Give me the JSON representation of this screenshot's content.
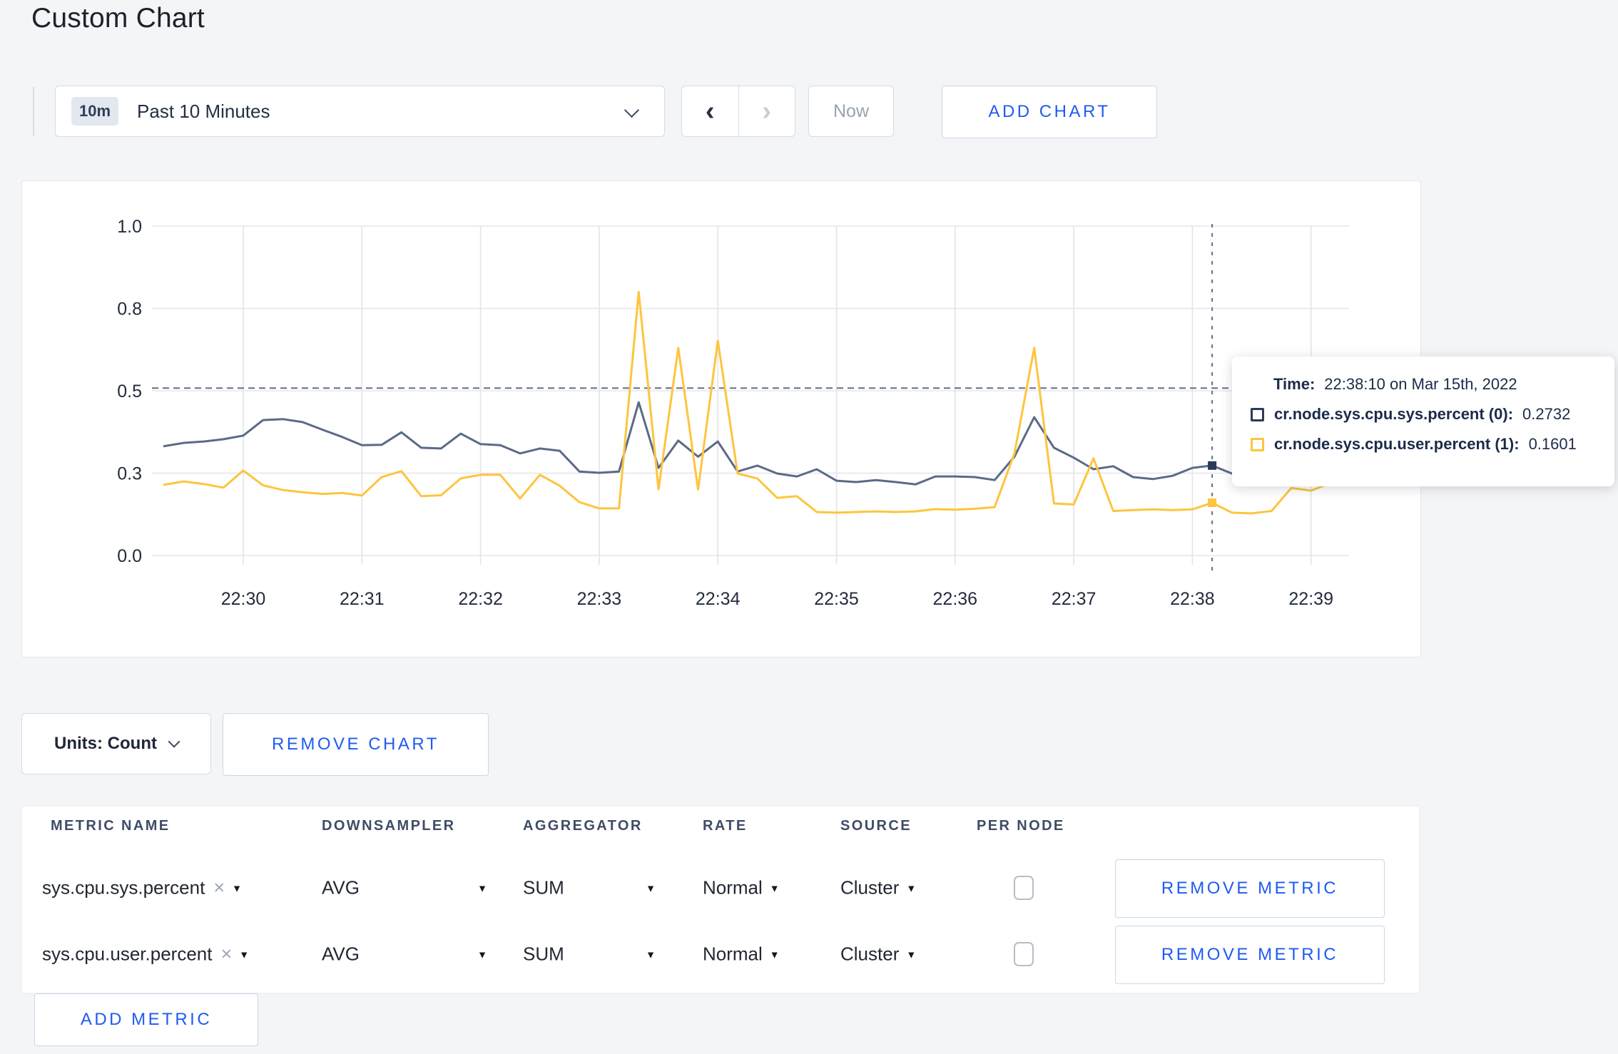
{
  "page": {
    "title": "Custom Chart"
  },
  "colors": {
    "accent_blue": "#1f5af2",
    "background": "#f4f5f7",
    "series_sys": "#5a6b87",
    "series_user": "#fdc53e",
    "crosshair": "#5e6f8a"
  },
  "icons": {
    "caret_down": "▼",
    "close": "×",
    "chevron_left": "‹",
    "chevron_right": "›"
  },
  "toolbar": {
    "time_range": {
      "badge": "10m",
      "label": "Past 10 Minutes"
    },
    "now_label": "Now",
    "add_chart_label": "ADD CHART"
  },
  "chart": {
    "tooltip": {
      "time_label": "Time:",
      "time_value": "22:38:10 on Mar 15th, 2022",
      "series": [
        {
          "label": "cr.node.sys.cpu.sys.percent (0):",
          "value": "0.2732",
          "color": "#2b3a58"
        },
        {
          "label": "cr.node.sys.cpu.user.percent (1):",
          "value": "0.1601",
          "color": "#fdc53e"
        }
      ]
    }
  },
  "chart_data": {
    "type": "line",
    "title": "",
    "xlabel": "",
    "ylabel": "",
    "ylim": [
      0,
      1
    ],
    "grid": true,
    "legend": "none",
    "xticks": [
      "22:30",
      "22:31",
      "22:32",
      "22:33",
      "22:34",
      "22:35",
      "22:36",
      "22:37",
      "22:38",
      "22:39"
    ],
    "yticks": {
      "values": [
        0,
        0.25,
        0.5,
        0.75,
        1.0
      ],
      "labels": [
        "0.0",
        "0.3",
        "0.5",
        "0.8",
        "1.0"
      ]
    },
    "crosshair": {
      "time": "22:38:10",
      "y": 0.508
    },
    "hover_points": [
      0.2732,
      0.1601
    ],
    "x": [
      "22:29:20",
      "22:29:30",
      "22:29:40",
      "22:29:50",
      "22:30:00",
      "22:30:10",
      "22:30:20",
      "22:30:30",
      "22:30:40",
      "22:30:50",
      "22:31:00",
      "22:31:10",
      "22:31:20",
      "22:31:30",
      "22:31:40",
      "22:31:50",
      "22:32:00",
      "22:32:10",
      "22:32:20",
      "22:32:30",
      "22:32:40",
      "22:32:50",
      "22:33:00",
      "22:33:10",
      "22:33:20",
      "22:33:30",
      "22:33:40",
      "22:33:50",
      "22:34:00",
      "22:34:10",
      "22:34:20",
      "22:34:30",
      "22:34:40",
      "22:34:50",
      "22:35:00",
      "22:35:10",
      "22:35:20",
      "22:35:30",
      "22:35:40",
      "22:35:50",
      "22:36:00",
      "22:36:10",
      "22:36:20",
      "22:36:30",
      "22:36:40",
      "22:36:50",
      "22:37:00",
      "22:37:10",
      "22:37:20",
      "22:37:30",
      "22:37:40",
      "22:37:50",
      "22:38:00",
      "22:38:10",
      "22:38:20",
      "22:38:30",
      "22:38:40",
      "22:38:50",
      "22:39:00",
      "22:39:10",
      "22:39:20"
    ],
    "series": [
      {
        "name": "cr.node.sys.cpu.sys.percent",
        "color": "#5a6b87",
        "marker": "#2b3a58",
        "values": [
          0.332,
          0.342,
          0.346,
          0.353,
          0.364,
          0.411,
          0.414,
          0.405,
          0.382,
          0.36,
          0.335,
          0.336,
          0.374,
          0.327,
          0.325,
          0.37,
          0.338,
          0.335,
          0.31,
          0.325,
          0.318,
          0.255,
          0.251,
          0.255,
          0.465,
          0.266,
          0.349,
          0.3,
          0.346,
          0.255,
          0.273,
          0.249,
          0.24,
          0.262,
          0.227,
          0.223,
          0.229,
          0.223,
          0.216,
          0.24,
          0.24,
          0.238,
          0.229,
          0.3,
          0.42,
          0.327,
          0.297,
          0.262,
          0.271,
          0.238,
          0.232,
          0.242,
          0.266,
          0.2732,
          0.249,
          0.252,
          0.27,
          0.3,
          0.29,
          0.305,
          0.33
        ]
      },
      {
        "name": "cr.node.sys.cpu.user.percent",
        "color": "#fdc53e",
        "marker": "#fdc53e",
        "values": [
          0.215,
          0.225,
          0.217,
          0.206,
          0.258,
          0.213,
          0.199,
          0.192,
          0.187,
          0.19,
          0.182,
          0.238,
          0.256,
          0.18,
          0.183,
          0.234,
          0.245,
          0.245,
          0.173,
          0.245,
          0.212,
          0.162,
          0.143,
          0.143,
          0.8,
          0.201,
          0.63,
          0.2,
          0.652,
          0.249,
          0.234,
          0.175,
          0.18,
          0.132,
          0.13,
          0.132,
          0.134,
          0.132,
          0.134,
          0.141,
          0.139,
          0.142,
          0.147,
          0.31,
          0.63,
          0.158,
          0.155,
          0.295,
          0.135,
          0.138,
          0.14,
          0.138,
          0.14,
          0.1601,
          0.13,
          0.128,
          0.135,
          0.205,
          0.197,
          0.22,
          0.27
        ]
      }
    ]
  },
  "units_bar": {
    "units_label": "Units: Count",
    "remove_chart_label": "REMOVE CHART"
  },
  "metrics_table": {
    "headers": [
      "METRIC NAME",
      "DOWNSAMPLER",
      "AGGREGATOR",
      "RATE",
      "SOURCE",
      "PER NODE"
    ],
    "rows": [
      {
        "metric": "sys.cpu.sys.percent",
        "downsampler": "AVG",
        "aggregator": "SUM",
        "rate": "Normal",
        "source": "Cluster",
        "per_node_checked": false,
        "remove_label": "REMOVE METRIC"
      },
      {
        "metric": "sys.cpu.user.percent",
        "downsampler": "AVG",
        "aggregator": "SUM",
        "rate": "Normal",
        "source": "Cluster",
        "per_node_checked": false,
        "remove_label": "REMOVE METRIC"
      }
    ],
    "add_metric_label": "ADD METRIC"
  }
}
